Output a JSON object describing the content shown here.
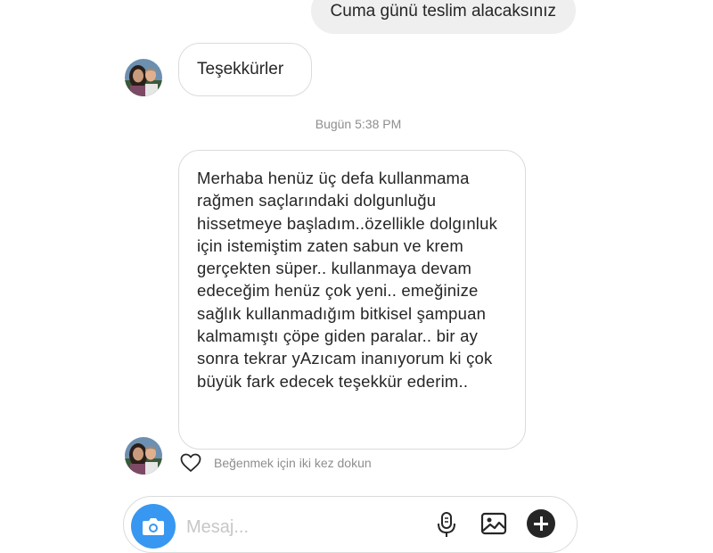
{
  "thread": {
    "sent_message": "Cuma günü teslim alacaksınız",
    "received_short": "Teşekkürler",
    "timestamp": "Bugün 5:38 PM",
    "received_long": "Merhaba henüz üç defa kullanmama rağmen saçlarındaki dolgunluğu hissetmeye başladım..özellikle dolgınluk için istemiştim zaten sabun ve krem gerçekten süper.. kullanmaya devam edeceğim henüz çok yeni.. emeğinize sağlık kullanmadığım bitkisel şampuan kalmamıştı çöpe giden paralar.. bir ay sonra tekrar yAzıcam inanıyorum ki çok büyük fark edecek teşekkür ederim..",
    "like_hint": "Beğenmek için iki kez dokun"
  },
  "composer": {
    "placeholder": "Mesaj..."
  },
  "colors": {
    "accent": "#3897f0",
    "sent_bubble": "#efefef",
    "border": "#dbdbdb",
    "secondary_text": "#8e8e8e"
  },
  "icons": [
    "camera-icon",
    "microphone-icon",
    "gallery-icon",
    "plus-icon",
    "heart-icon"
  ]
}
